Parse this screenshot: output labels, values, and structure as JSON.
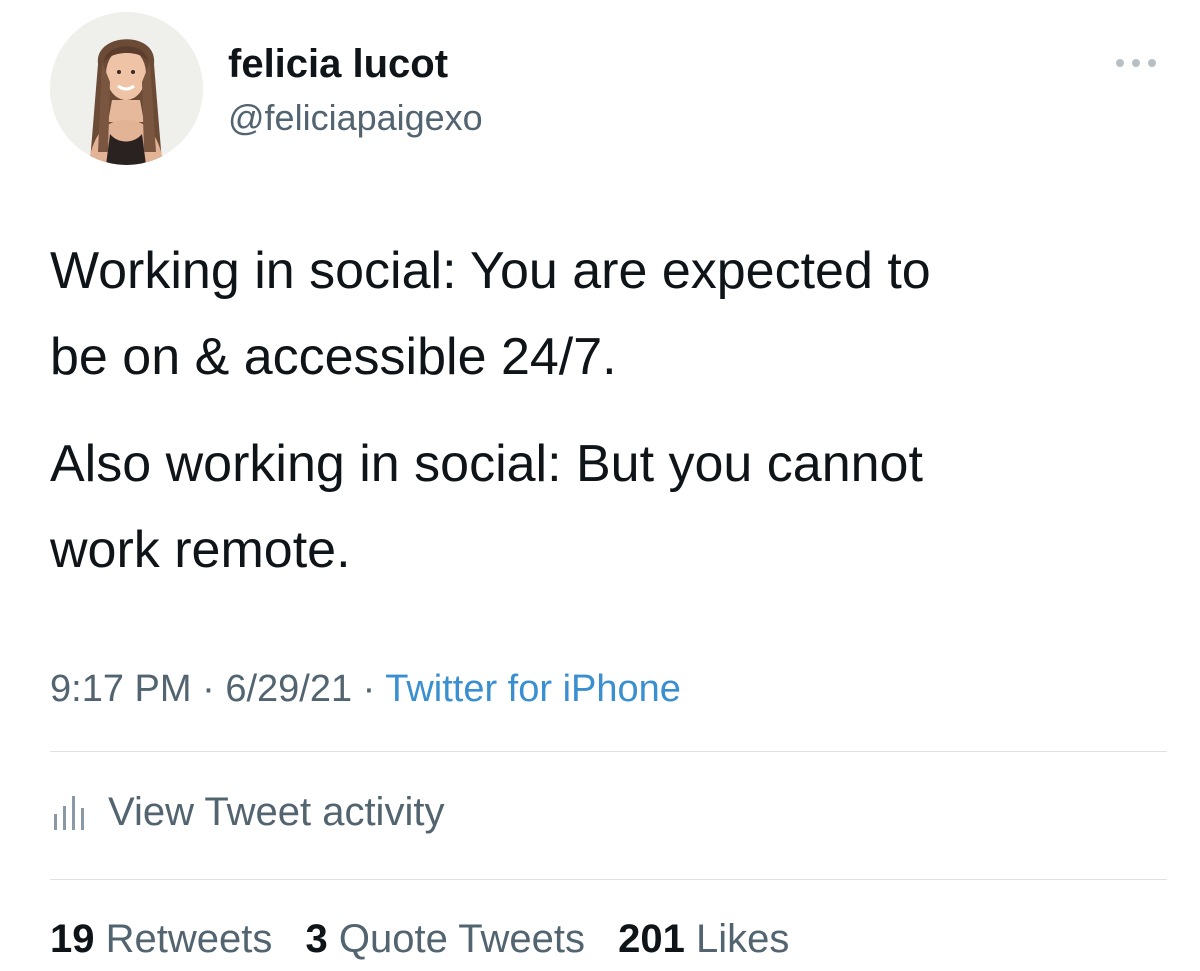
{
  "author": {
    "display_name": "felicia lucot",
    "handle": "@feliciapaigexo",
    "avatar_icon": "profile-photo"
  },
  "more_icon": "more-horizontal-icon",
  "tweet": {
    "paragraph_1": [
      "Working in social: You are expected to",
      "be on & accessible 24/7."
    ],
    "paragraph_2": [
      "Also working in social: But you cannot",
      "work remote."
    ]
  },
  "meta": {
    "time": "9:17 PM",
    "separator": "·",
    "date": "6/29/21",
    "source": "Twitter for iPhone"
  },
  "activity": {
    "icon": "bar-chart-icon",
    "label": "View Tweet activity"
  },
  "stats": {
    "retweets_count": "19",
    "retweets_label": "Retweets",
    "quotes_count": "3",
    "quotes_label": "Quote Tweets",
    "likes_count": "201",
    "likes_label": "Likes"
  },
  "colors": {
    "text_primary": "#0f1419",
    "text_secondary": "#536471",
    "link": "#3a8fd0",
    "divider": "#dde1e4"
  }
}
